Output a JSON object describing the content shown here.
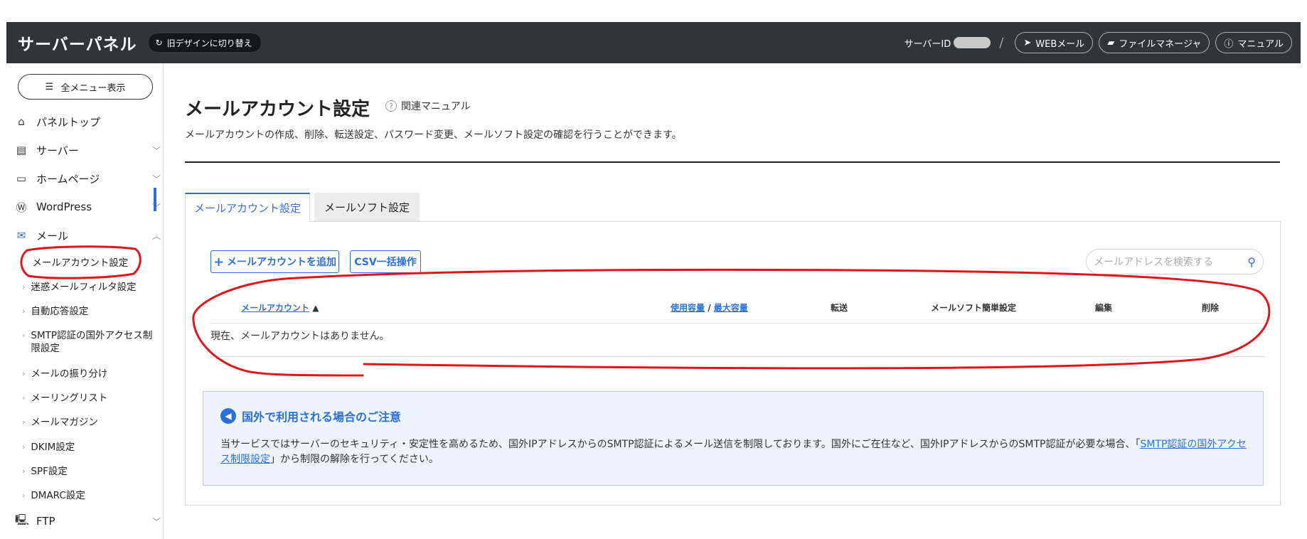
{
  "header": {
    "brand": "サーバーパネル",
    "switch_design": "旧デザインに切り替え",
    "server_id_label": "サーバーID",
    "webmail": "WEBメール",
    "file_manager": "ファイルマネージャ",
    "manual": "マニュアル"
  },
  "sidebar": {
    "all_menu": "全メニュー表示",
    "items": [
      {
        "label": "パネルトップ",
        "icon": "home-icon"
      },
      {
        "label": "サーバー",
        "icon": "server-icon"
      },
      {
        "label": "ホームページ",
        "icon": "window-icon"
      },
      {
        "label": "WordPress",
        "icon": "wordpress-icon"
      },
      {
        "label": "メール",
        "icon": "mail-icon"
      }
    ],
    "mail_sub": [
      "メールアカウント設定",
      "迷惑メールフィルタ設定",
      "自動応答設定",
      "SMTP認証の国外アクセス制限設定",
      "メールの振り分け",
      "メーリングリスト",
      "メールマガジン",
      "DKIM設定",
      "SPF設定",
      "DMARC設定"
    ],
    "ftp": "FTP"
  },
  "main": {
    "title": "メールアカウント設定",
    "manual_link": "関連マニュアル",
    "description": "メールアカウントの作成、削除、転送設定、パスワード変更、メールソフト設定の確認を行うことができます。",
    "tabs": [
      "メールアカウント設定",
      "メールソフト設定"
    ],
    "add_button": "メールアカウントを追加",
    "csv_button": "CSV一括操作",
    "search_placeholder": "メールアドレスを検索する",
    "columns": {
      "account": "メールアカウント",
      "sort_mark": "▲",
      "usage": "使用容量",
      "sep": " / ",
      "max": "最大容量",
      "forward": "転送",
      "easy_setup": "メールソフト簡単設定",
      "edit": "編集",
      "delete": "削除"
    },
    "empty_message": "現在、メールアカウントはありません。",
    "notice": {
      "title": "国外で利用される場合のご注意",
      "body_before": "当サービスではサーバーのセキュリティ・安定性を高めるため、国外IPアドレスからのSMTP認証によるメール送信を制限しております。国外にご在住など、国外IPアドレスからのSMTP認証が必要な場合、「",
      "link": "SMTP認証の国外アクセス制限設定",
      "body_after": "」から制限の解除を行ってください。"
    }
  },
  "colors": {
    "accent": "#2d6fd6",
    "topbar": "#2f353b",
    "annotation": "#e0161b"
  }
}
